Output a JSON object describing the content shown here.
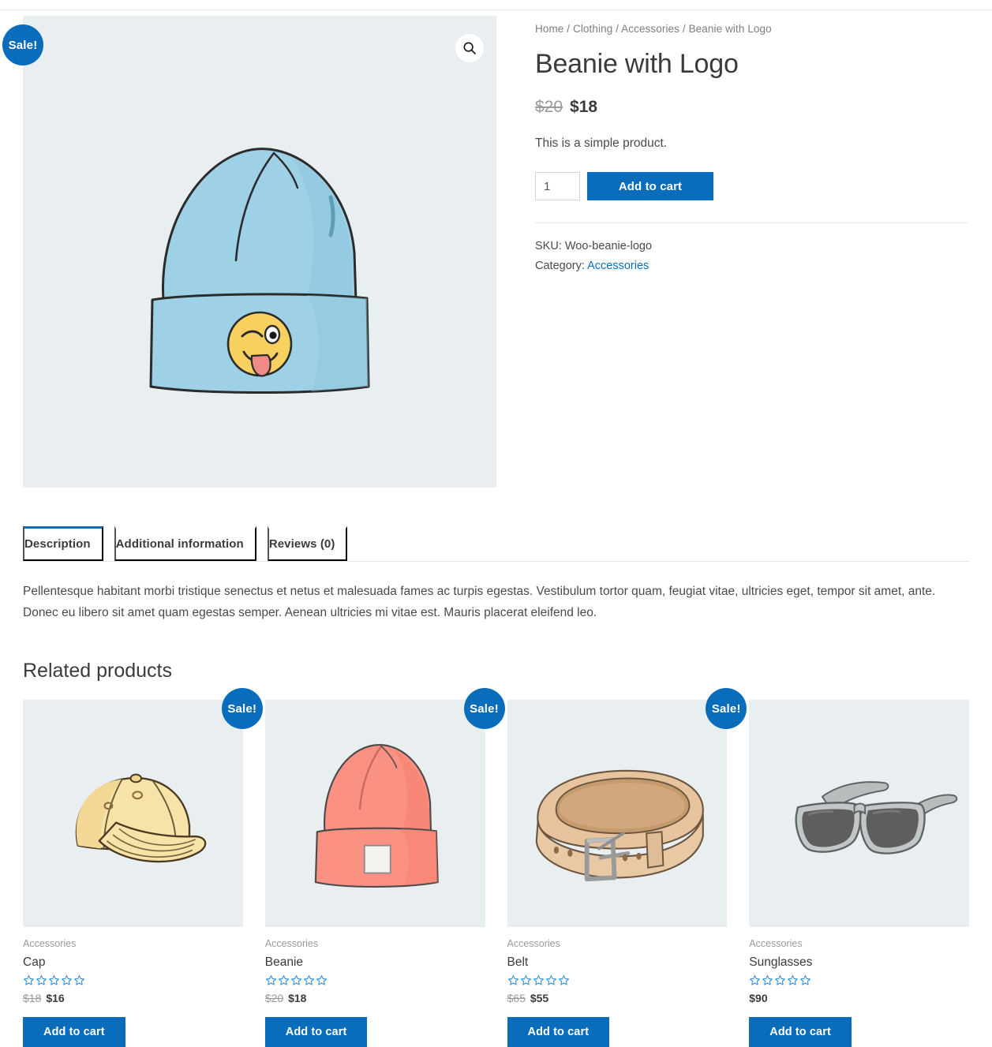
{
  "theme": {
    "accent": "#0a6dbb",
    "image_bg": "#e9eef0",
    "text": "#3b3b3b",
    "muted": "#9a9a9a"
  },
  "breadcrumb": {
    "items": [
      "Home",
      "Clothing",
      "Accessories",
      "Beanie with Logo"
    ],
    "separator": "/"
  },
  "product": {
    "title": "Beanie with Logo",
    "price_old": "$20",
    "price_new": "$18",
    "short_description": "This is a simple product.",
    "quantity_value": "1",
    "add_to_cart_label": "Add to cart",
    "sale_badge": "Sale!",
    "sku_label": "SKU:",
    "sku_value": "Woo-beanie-logo",
    "category_label": "Category:",
    "category_value": "Accessories",
    "zoom_icon": "search-icon",
    "image_alt": "blue-beanie-with-winking-emoji"
  },
  "tabs": {
    "items": [
      {
        "label": "Description",
        "active": true
      },
      {
        "label": "Additional information",
        "active": false
      },
      {
        "label": "Reviews (0)",
        "active": false
      }
    ],
    "description_text": "Pellentesque habitant morbi tristique senectus et netus et malesuada fames ac turpis egestas. Vestibulum tortor quam, feugiat vitae, ultricies eget, tempor sit amet, ante. Donec eu libero sit amet quam egestas semper. Aenean ultricies mi vitae est. Mauris placerat eleifend leo."
  },
  "related": {
    "heading": "Related products",
    "add_to_cart_label": "Add to cart",
    "sale_badge": "Sale!",
    "rating_stars": 5,
    "rating_filled": 0,
    "products": [
      {
        "category": "Accessories",
        "name": "Cap",
        "price_old": "$18",
        "price_new": "$16",
        "on_sale": true,
        "image_alt": "yellow-baseball-cap"
      },
      {
        "category": "Accessories",
        "name": "Beanie",
        "price_old": "$20",
        "price_new": "$18",
        "on_sale": true,
        "image_alt": "coral-beanie"
      },
      {
        "category": "Accessories",
        "name": "Belt",
        "price_old": "$65",
        "price_new": "$55",
        "on_sale": true,
        "image_alt": "tan-leather-belt"
      },
      {
        "category": "Accessories",
        "name": "Sunglasses",
        "price_old": "",
        "price_new": "$90",
        "on_sale": false,
        "image_alt": "gray-sunglasses"
      }
    ]
  }
}
